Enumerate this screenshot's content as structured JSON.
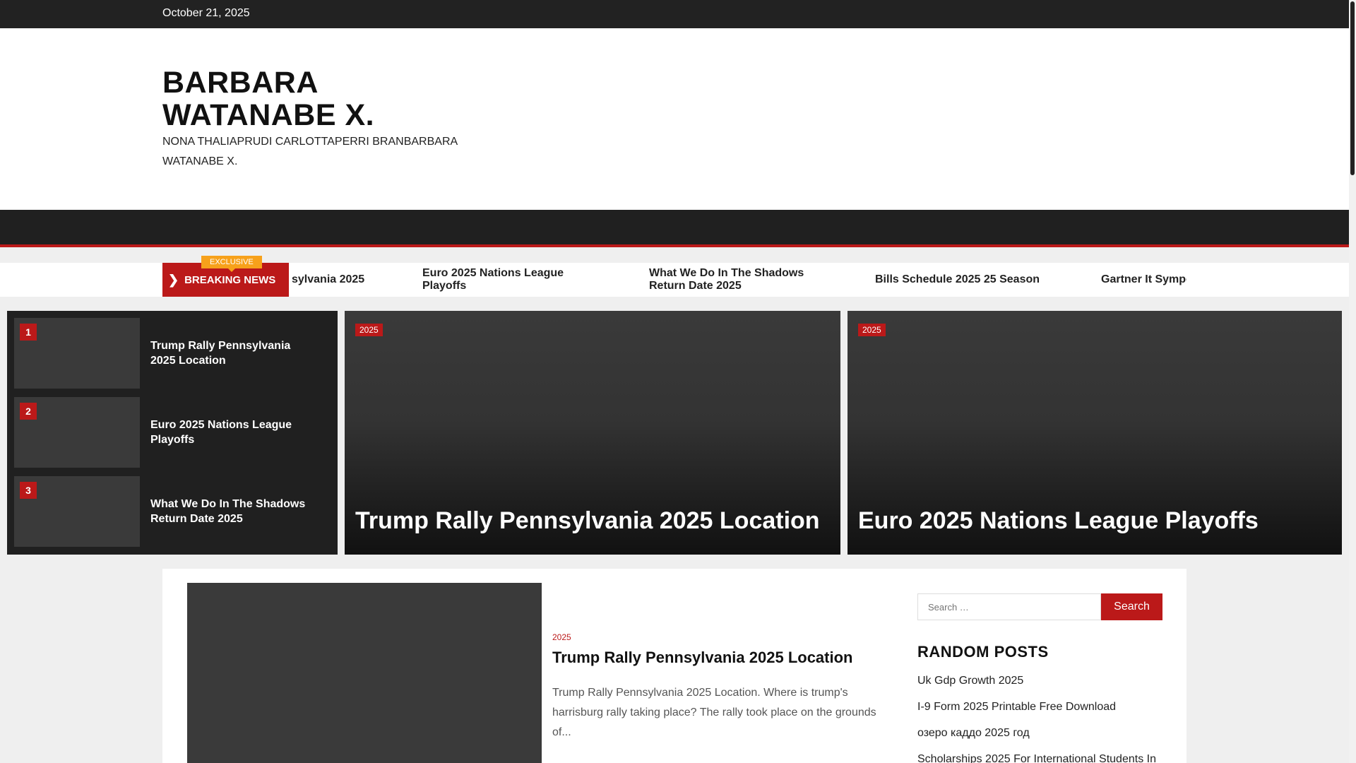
{
  "topbar": {
    "date": "October 21, 2025"
  },
  "header": {
    "site_title": "BARBARA WATANABE X.",
    "tagline": "NONA THALIAPRUDI CARLOTTAPERRI BRANBARBARA WATANABE X."
  },
  "breaking": {
    "label": "BREAKING NEWS",
    "exclusive": "EXCLUSIVE",
    "items": [
      "sylvania 2025",
      "Euro 2025 Nations League Playoffs",
      "What We Do In The Shadows Return Date 2025",
      "Bills Schedule 2025 25 Season",
      "Gartner It Symposium"
    ]
  },
  "trending": [
    {
      "num": "1",
      "title": "Trump Rally Pennsylvania 2025 Location"
    },
    {
      "num": "2",
      "title": "Euro 2025 Nations League Playoffs"
    },
    {
      "num": "3",
      "title": "What We Do In The Shadows Return Date 2025"
    }
  ],
  "featured": [
    {
      "category": "2025",
      "title": "Trump Rally Pennsylvania 2025 Location"
    },
    {
      "category": "2025",
      "title": "Euro 2025 Nations League Playoffs"
    }
  ],
  "post": {
    "category": "2025",
    "title": "Trump Rally Pennsylvania 2025 Location",
    "excerpt": "Trump Rally Pennsylvania 2025 Location. Where is trump's harrisburg rally taking place? The rally took place on the grounds of..."
  },
  "sidebar": {
    "search_placeholder": "Search …",
    "search_button": "Search",
    "random_heading": "RANDOM POSTS",
    "random_posts": [
      "Uk Gdp Growth 2025",
      "I-9 Form 2025 Printable Free Download",
      "озеро каддо 2025 год",
      "Scholarships 2025 For International Students In"
    ]
  },
  "colors": {
    "accent": "#bb1919",
    "exclusive": "#f7a11b",
    "dark": "#202020"
  }
}
